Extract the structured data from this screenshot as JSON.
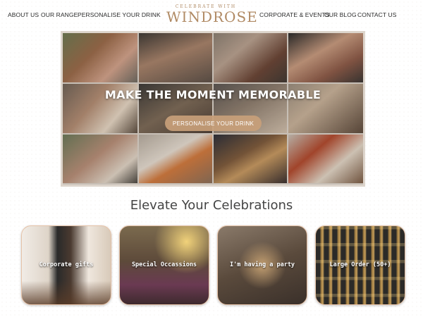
{
  "nav": {
    "left": [
      "ABOUT US",
      "OUR RANGE",
      "PERSONALISE YOUR DRINK"
    ],
    "right": [
      "CORPORATE & EVENTS",
      "OUR BLOG",
      "CONTACT US"
    ]
  },
  "logo": {
    "tagline": "CELEBRATE WITH",
    "brand": "WINDROSE"
  },
  "hero": {
    "title": "MAKE THE MOMENT MEMORABLE",
    "button_label": "PERSONALISE YOUR DRINK"
  },
  "section": {
    "title": "Elevate Your Celebrations"
  },
  "cards": [
    {
      "label": "Corporate gifts"
    },
    {
      "label": "Special Occassions"
    },
    {
      "label": "I'm having a party"
    },
    {
      "label": "Large Order (50+)"
    }
  ],
  "colors": {
    "accent": "#b08a64",
    "button": "#c8a07a"
  }
}
